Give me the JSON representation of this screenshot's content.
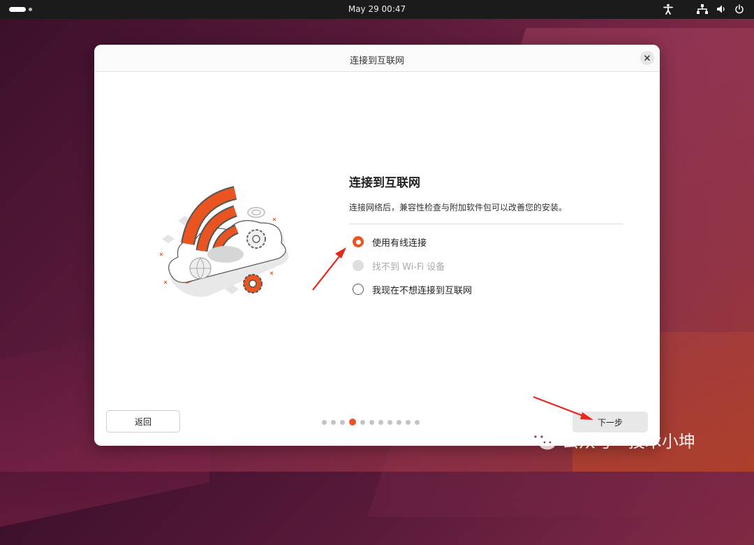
{
  "topbar": {
    "clock": "May 29  00:47",
    "icons": [
      "accessibility-icon",
      "network-icon",
      "volume-icon",
      "power-icon"
    ]
  },
  "dialog": {
    "title": "连接到互联网",
    "close_icon": "close-icon"
  },
  "main": {
    "heading": "连接到互联网",
    "description": "连接网络后，兼容性检查与附加软件包可以改善您的安装。",
    "options": [
      {
        "label": "使用有线连接",
        "state": "checked"
      },
      {
        "label": "找不到 Wi-Fi 设备",
        "state": "disabled"
      },
      {
        "label": "我现在不想连接到互联网",
        "state": "unchecked"
      }
    ]
  },
  "footer": {
    "back_label": "返回",
    "next_label": "下一步",
    "step_total": 11,
    "step_current": 4
  },
  "watermark": {
    "text": "公众号 · 技术小坤"
  },
  "colors": {
    "accent": "#e95420",
    "annotation_arrow": "#e8261e"
  }
}
